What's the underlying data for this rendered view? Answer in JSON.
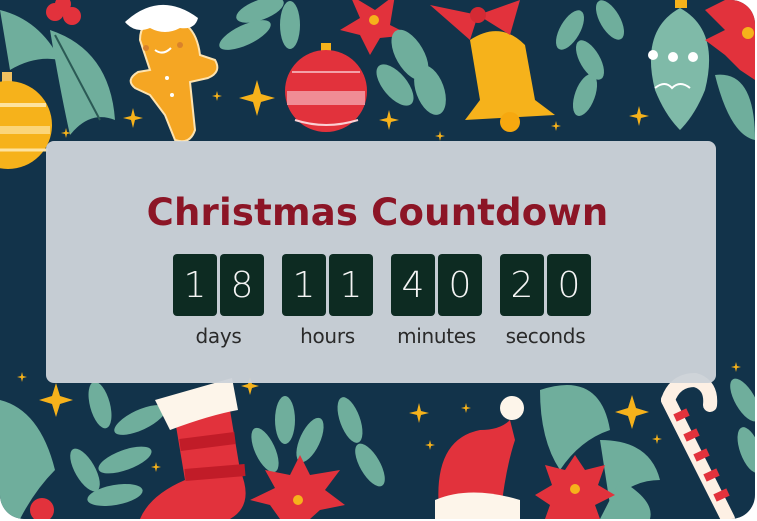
{
  "title": "Christmas Countdown",
  "countdown": [
    {
      "unit": "days",
      "digits": [
        "1",
        "8"
      ]
    },
    {
      "unit": "hours",
      "digits": [
        "1",
        "1"
      ]
    },
    {
      "unit": "minutes",
      "digits": [
        "4",
        "0"
      ]
    },
    {
      "unit": "seconds",
      "digits": [
        "2",
        "0"
      ]
    }
  ],
  "colors": {
    "background": "#12334a",
    "panel": "#cdd2d8",
    "title": "#8c1526",
    "digit_box": "#0d2b22",
    "digit_text": "#f4f4f4",
    "leaf": "#6fae9c",
    "red": "#e2323c",
    "gold": "#f6b21b"
  },
  "decorations": [
    "holly-leaves",
    "gingerbread-man",
    "red-ornament",
    "gold-bell",
    "teal-ornament",
    "poinsettia",
    "gold-ornament",
    "christmas-stocking",
    "santa-hat",
    "candy-cane",
    "sparkle-stars",
    "leaf-branches"
  ]
}
